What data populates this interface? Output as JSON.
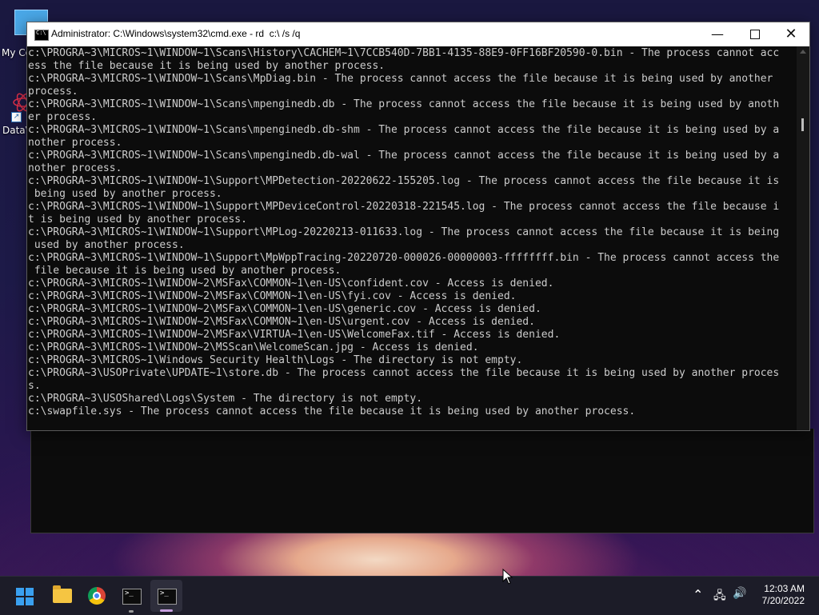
{
  "desktop": {
    "icons": [
      {
        "label": "My Co"
      },
      {
        "label": "DataV"
      }
    ]
  },
  "window": {
    "title": "Administrator: C:\\Windows\\system32\\cmd.exe - rd  c:\\ /s /q",
    "controls": {
      "minimize": "—",
      "close": "✕"
    }
  },
  "console": {
    "lines": [
      "c:\\PROGRA~3\\MICROS~1\\WINDOW~1\\Scans\\History\\CACHEM~1\\7CCB540D-7BB1-4135-88E9-0FF16BF20590-0.bin - The process cannot acc",
      "ess the file because it is being used by another process.",
      "c:\\PROGRA~3\\MICROS~1\\WINDOW~1\\Scans\\MpDiag.bin - The process cannot access the file because it is being used by another",
      "process.",
      "c:\\PROGRA~3\\MICROS~1\\WINDOW~1\\Scans\\mpenginedb.db - The process cannot access the file because it is being used by anoth",
      "er process.",
      "c:\\PROGRA~3\\MICROS~1\\WINDOW~1\\Scans\\mpenginedb.db-shm - The process cannot access the file because it is being used by a",
      "nother process.",
      "c:\\PROGRA~3\\MICROS~1\\WINDOW~1\\Scans\\mpenginedb.db-wal - The process cannot access the file because it is being used by a",
      "nother process.",
      "c:\\PROGRA~3\\MICROS~1\\WINDOW~1\\Support\\MPDetection-20220622-155205.log - The process cannot access the file because it is",
      " being used by another process.",
      "c:\\PROGRA~3\\MICROS~1\\WINDOW~1\\Support\\MPDeviceControl-20220318-221545.log - The process cannot access the file because i",
      "t is being used by another process.",
      "c:\\PROGRA~3\\MICROS~1\\WINDOW~1\\Support\\MPLog-20220213-011633.log - The process cannot access the file because it is being",
      " used by another process.",
      "c:\\PROGRA~3\\MICROS~1\\WINDOW~1\\Support\\MpWppTracing-20220720-000026-00000003-ffffffff.bin - The process cannot access the",
      " file because it is being used by another process.",
      "c:\\PROGRA~3\\MICROS~1\\WINDOW~2\\MSFax\\COMMON~1\\en-US\\confident.cov - Access is denied.",
      "c:\\PROGRA~3\\MICROS~1\\WINDOW~2\\MSFax\\COMMON~1\\en-US\\fyi.cov - Access is denied.",
      "c:\\PROGRA~3\\MICROS~1\\WINDOW~2\\MSFax\\COMMON~1\\en-US\\generic.cov - Access is denied.",
      "c:\\PROGRA~3\\MICROS~1\\WINDOW~2\\MSFax\\COMMON~1\\en-US\\urgent.cov - Access is denied.",
      "c:\\PROGRA~3\\MICROS~1\\WINDOW~2\\MSFax\\VIRTUA~1\\en-US\\WelcomeFax.tif - Access is denied.",
      "c:\\PROGRA~3\\MICROS~1\\WINDOW~2\\MSScan\\WelcomeScan.jpg - Access is denied.",
      "c:\\PROGRA~3\\MICROS~1\\Windows Security Health\\Logs - The directory is not empty.",
      "c:\\PROGRA~3\\USOPrivate\\UPDATE~1\\store.db - The process cannot access the file because it is being used by another proces",
      "s.",
      "c:\\PROGRA~3\\USOShared\\Logs\\System - The directory is not empty.",
      "c:\\swapfile.sys - The process cannot access the file because it is being used by another process."
    ]
  },
  "taskbar": {
    "apps": [
      {
        "name": "start"
      },
      {
        "name": "file-explorer"
      },
      {
        "name": "chrome"
      },
      {
        "name": "terminal-1"
      },
      {
        "name": "terminal-2"
      }
    ],
    "tray": {
      "chevron": "⌃",
      "network": "🖧",
      "volume": "🔊"
    },
    "time": "12:03 AM",
    "date": "7/20/2022"
  },
  "colors": {
    "console_bg": "#0c0c0c",
    "console_text": "#cccccc",
    "accent": "#3aa0f0"
  }
}
